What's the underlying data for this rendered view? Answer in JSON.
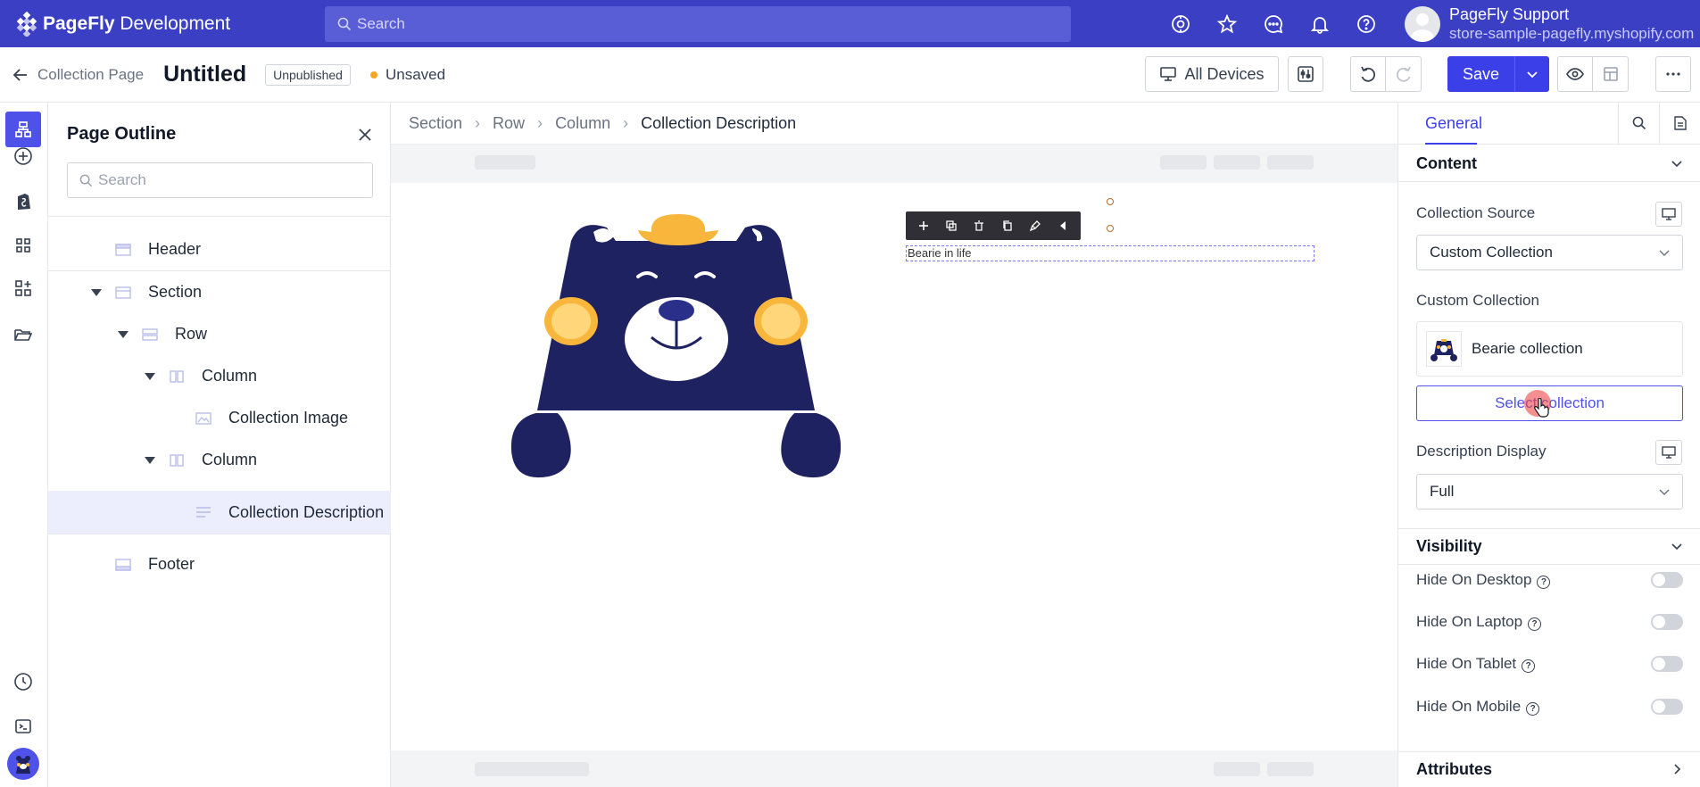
{
  "app": {
    "brand_name": "PageFly",
    "brand_suffix": "Development",
    "search_placeholder": "Search",
    "user_name": "PageFly Support",
    "user_store": "store-sample-pagefly.myshopify.com"
  },
  "page": {
    "back_label": "Collection Page",
    "title": "Untitled",
    "status_badge": "Unpublished",
    "save_state": "Unsaved",
    "devices_label": "All Devices",
    "save_label": "Save"
  },
  "outline": {
    "title": "Page Outline",
    "search_placeholder": "Search",
    "items": [
      {
        "label": "Header",
        "depth": 0,
        "expanded": false
      },
      {
        "label": "Section",
        "depth": 0,
        "expanded": true
      },
      {
        "label": "Row",
        "depth": 1,
        "expanded": true
      },
      {
        "label": "Column",
        "depth": 2,
        "expanded": true
      },
      {
        "label": "Collection Image",
        "depth": 3,
        "expanded": false
      },
      {
        "label": "Column",
        "depth": 2,
        "expanded": true
      },
      {
        "label": "Collection Description",
        "depth": 3,
        "expanded": false,
        "selected": true
      },
      {
        "label": "Footer",
        "depth": 0,
        "expanded": false
      }
    ]
  },
  "breadcrumb": [
    "Section",
    "Row",
    "Column",
    "Collection Description"
  ],
  "canvas": {
    "description_text": "Bearie in life"
  },
  "panel": {
    "tab_general": "General",
    "content_heading": "Content",
    "collection_source_label": "Collection Source",
    "collection_source_value": "Custom Collection",
    "custom_collection_label": "Custom Collection",
    "collection_name": "Bearie collection",
    "select_collection_label": "Select collection",
    "description_display_label": "Description Display",
    "description_display_value": "Full",
    "visibility_heading": "Visibility",
    "hide_desktop": "Hide On Desktop",
    "hide_laptop": "Hide On Laptop",
    "hide_tablet": "Hide On Tablet",
    "hide_mobile": "Hide On Mobile",
    "attributes_heading": "Attributes"
  },
  "colors": {
    "brand": "#3b3fc4",
    "accent": "#3b3fe8",
    "bear_navy": "#1f2260",
    "bear_yellow": "#f8b73c"
  }
}
